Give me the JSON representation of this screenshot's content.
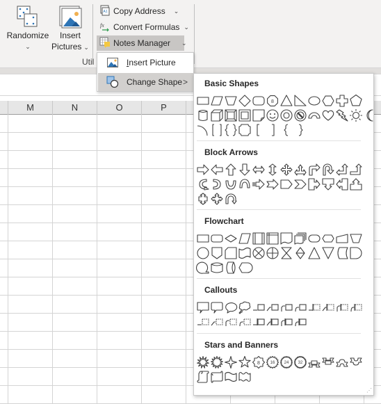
{
  "ribbon": {
    "randomize": {
      "label": "Randomize",
      "icon": "dice-icon"
    },
    "insert_pictures": {
      "label_line1": "Insert",
      "label_line2": "Pictures",
      "icon": "picture-icon"
    },
    "copy_address": {
      "label": "Copy Address",
      "icon": "cell-address-icon"
    },
    "convert_formulas": {
      "label": "Convert Formulas",
      "icon": "fx-icon"
    },
    "notes_manager": {
      "label": "Notes Manager",
      "icon": "notes-icon"
    },
    "group_label": "Util"
  },
  "columns": [
    "M",
    "N",
    "O",
    "P"
  ],
  "menu": {
    "items": [
      {
        "label_accel": "I",
        "label_rest": "nsert Picture",
        "icon": "picture-icon"
      },
      {
        "label": "Change Shape",
        "icon": "change-shape-icon",
        "arrow": ">"
      }
    ]
  },
  "gallery": {
    "sections": [
      {
        "title": "Basic Shapes",
        "rows": [
          [
            "rectangle",
            "parallelogram",
            "trapezoid",
            "diamond",
            "rounded-rectangle",
            "octagon",
            "triangle",
            "right-triangle",
            "oval",
            "hexagon",
            "cross",
            "pentagon"
          ],
          [
            "can",
            "cube",
            "bevel",
            "frame",
            "folded-corner",
            "smiley-face",
            "donut",
            "no-symbol",
            "block-arc",
            "heart",
            "lightning-bolt",
            "sun",
            "moon"
          ],
          [
            "arc",
            "double-bracket",
            "double-brace",
            "plaque",
            "left-bracket",
            "right-bracket",
            "left-brace",
            "right-brace"
          ]
        ]
      },
      {
        "title": "Block Arrows",
        "rows": [
          [
            "right-arrow",
            "left-arrow",
            "up-arrow",
            "down-arrow",
            "left-right-arrow",
            "up-down-arrow",
            "quad-arrow",
            "left-right-up-arrow",
            "bent-arrow",
            "u-turn-arrow",
            "left-up-arrow",
            "bent-up-arrow"
          ],
          [
            "curved-right-arrow",
            "curved-left-arrow",
            "curved-up-arrow",
            "curved-down-arrow",
            "striped-right-arrow",
            "notched-right-arrow",
            "pentagon-arrow",
            "chevron",
            "right-arrow-callout",
            "down-arrow-callout",
            "left-arrow-callout",
            "up-arrow-callout"
          ],
          [
            "up-down-arrow-callout",
            "quad-arrow-callout",
            "circular-arrow"
          ]
        ]
      },
      {
        "title": "Flowchart",
        "rows": [
          [
            "process",
            "alternate-process",
            "decision",
            "data",
            "predefined-process",
            "internal-storage",
            "document",
            "multidocument",
            "terminator",
            "preparation",
            "manual-input",
            "manual-operation"
          ],
          [
            "connector",
            "off-page-connector",
            "card",
            "punched-tape",
            "summing-junction",
            "or",
            "collate",
            "sort",
            "extract",
            "merge",
            "stored-data",
            "delay"
          ],
          [
            "sequential-access-storage",
            "magnetic-disk",
            "direct-access-storage",
            "display"
          ]
        ]
      },
      {
        "title": "Callouts",
        "rows": [
          [
            "rectangular-callout",
            "rounded-rectangular-callout",
            "oval-callout",
            "cloud-callout",
            "line-callout-1",
            "line-callout-2",
            "line-callout-3",
            "line-callout-4",
            "line-callout-1-accent-bar",
            "line-callout-2-accent-bar",
            "line-callout-3-accent-bar",
            "line-callout-4-accent-bar"
          ],
          [
            "line-callout-1-no-border",
            "line-callout-2-no-border",
            "line-callout-3-no-border",
            "line-callout-4-no-border",
            "line-callout-1-border-accent",
            "line-callout-2-border-accent",
            "line-callout-3-border-accent",
            "line-callout-4-border-accent"
          ]
        ]
      },
      {
        "title": "Stars and Banners",
        "rows": [
          [
            "explosion-1",
            "explosion-2",
            "4-point-star",
            "5-point-star",
            "8-point-star",
            "16-point-star",
            "24-point-star",
            "32-point-star",
            "up-ribbon",
            "down-ribbon",
            "curved-up-ribbon",
            "curved-down-ribbon"
          ],
          [
            "vertical-scroll",
            "horizontal-scroll",
            "wave",
            "double-wave"
          ]
        ]
      }
    ],
    "star_labels": {
      "8-point-star": "8",
      "16-point-star": "16",
      "24-point-star": "24",
      "32-point-star": "32",
      "octagon": "8"
    }
  },
  "colors": {
    "accent_blue": "#2e75b6",
    "notes_yellow": "#f4c842",
    "menu_hover": "#d2d0ce"
  }
}
